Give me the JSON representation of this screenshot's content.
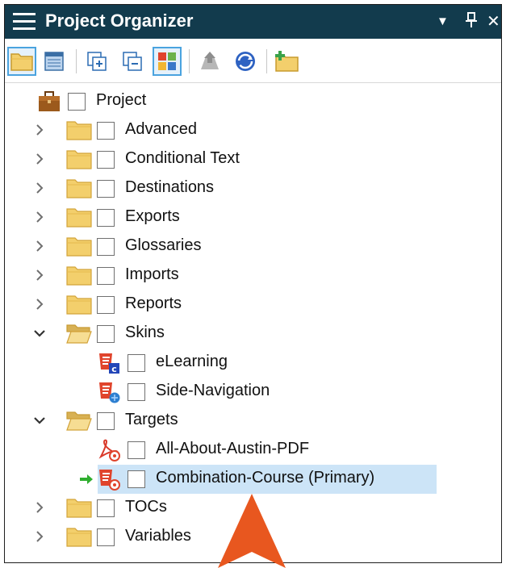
{
  "window": {
    "title": "Project Organizer",
    "dropdown_glyph": "▼",
    "pin_glyph": "⊥",
    "close_glyph": "✕"
  },
  "toolbar": {
    "buttons": [
      {
        "icon": "open-folder-icon",
        "selected": true
      },
      {
        "icon": "properties-icon",
        "selected": false
      },
      {
        "icon": "expand-all-icon",
        "selected": false
      },
      {
        "icon": "collapse-all-icon",
        "selected": false
      },
      {
        "icon": "show-files-icon",
        "selected": true
      },
      {
        "icon": "publish-icon",
        "selected": false
      },
      {
        "icon": "refresh-icon",
        "selected": false
      },
      {
        "icon": "add-folder-icon",
        "selected": false
      }
    ]
  },
  "tree": {
    "root": {
      "label": "Project",
      "icon": "briefcase-icon"
    },
    "items": [
      {
        "label": "Advanced",
        "expanded": false
      },
      {
        "label": "Conditional Text",
        "expanded": false
      },
      {
        "label": "Destinations",
        "expanded": false
      },
      {
        "label": "Exports",
        "expanded": false
      },
      {
        "label": "Glossaries",
        "expanded": false
      },
      {
        "label": "Imports",
        "expanded": false
      },
      {
        "label": "Reports",
        "expanded": false
      },
      {
        "label": "Skins",
        "expanded": true,
        "children": [
          {
            "label": "eLearning",
            "icon": "skin-elearning-icon"
          },
          {
            "label": "Side-Navigation",
            "icon": "skin-side-navigation-icon"
          }
        ]
      },
      {
        "label": "Targets",
        "expanded": true,
        "children": [
          {
            "label": "All-About-Austin-PDF",
            "icon": "pdf-target-icon"
          },
          {
            "label": "Combination-Course (Primary)",
            "icon": "html5-target-icon",
            "primary": true,
            "selected": true
          }
        ]
      },
      {
        "label": "TOCs",
        "expanded": false
      },
      {
        "label": "Variables",
        "expanded": false
      }
    ]
  },
  "colors": {
    "titlebar": "#123b4d",
    "selection": "#cce4f7",
    "folder": "#f3cf6c",
    "accent_red": "#e0442c",
    "cursor": "#e8571f"
  }
}
